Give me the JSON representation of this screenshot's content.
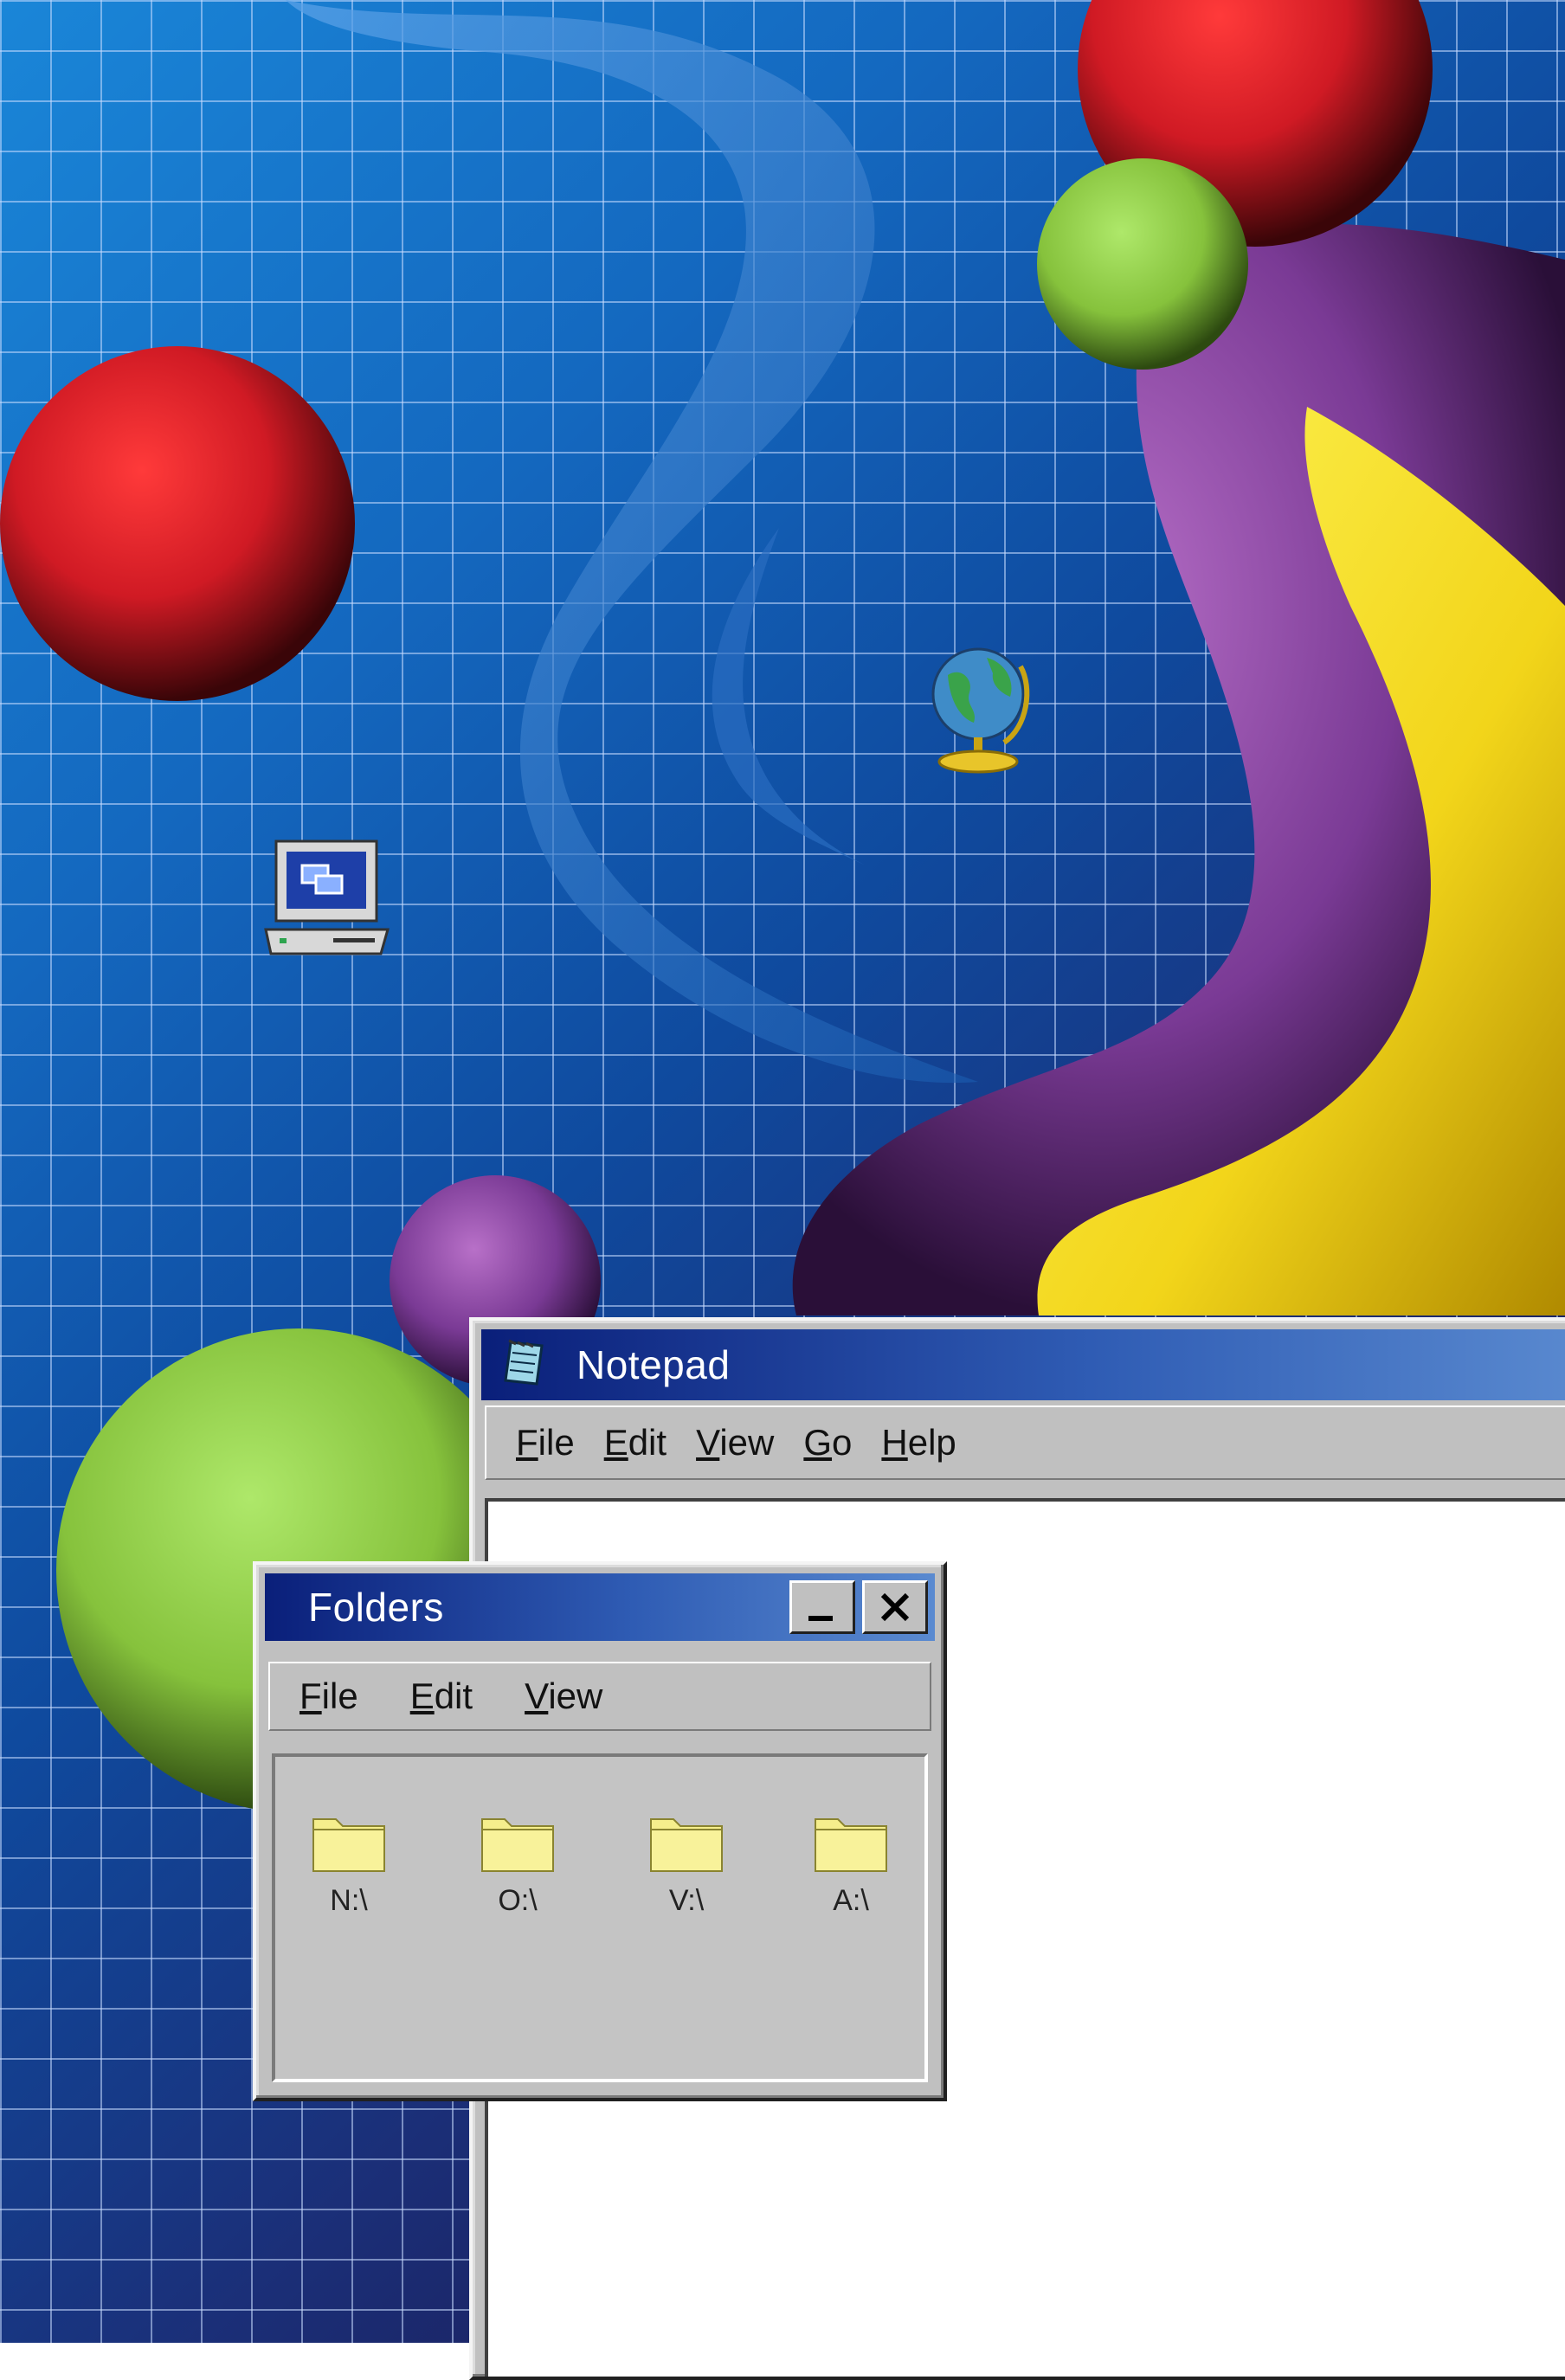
{
  "desktop": {
    "icons": [
      {
        "name": "my-computer-icon"
      },
      {
        "name": "internet-globe-icon"
      }
    ]
  },
  "notepad": {
    "title": "Notepad",
    "menu": [
      {
        "label": "File",
        "key": "F",
        "rest": "ile"
      },
      {
        "label": "Edit",
        "key": "E",
        "rest": "dit"
      },
      {
        "label": "View",
        "key": "V",
        "rest": "iew"
      },
      {
        "label": "Go",
        "key": "G",
        "rest": "o"
      },
      {
        "label": "Help",
        "key": "H",
        "rest": "elp"
      }
    ],
    "content": ""
  },
  "folders": {
    "title": "Folders",
    "menu": [
      {
        "label": "File",
        "key": "F",
        "rest": "ile"
      },
      {
        "label": "Edit",
        "key": "E",
        "rest": "dit"
      },
      {
        "label": "View",
        "key": "V",
        "rest": "iew"
      }
    ],
    "drives": [
      "N:\\",
      "O:\\",
      "V:\\",
      "A:\\"
    ]
  },
  "colors": {
    "titlebar_start": "#0a1f7a",
    "titlebar_end": "#5a8ad0",
    "window_face": "#c0c0c0",
    "folder_yellow": "#f5ee8c"
  }
}
